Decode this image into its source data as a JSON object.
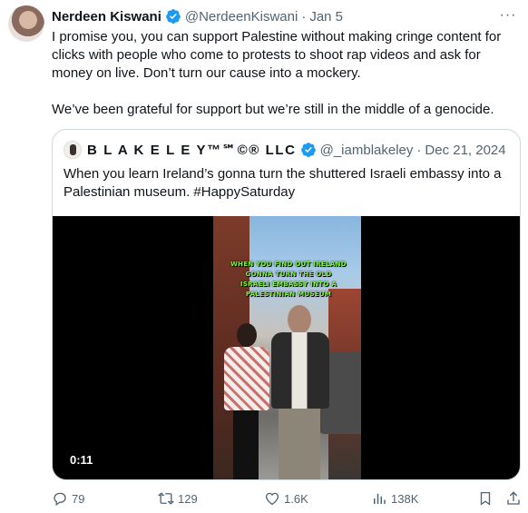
{
  "tweet": {
    "display_name": "Nerdeen Kiswani",
    "handle": "@NerdeenKiswani",
    "separator": "·",
    "date": "Jan 5",
    "more": "···",
    "paragraph1": "I promise you, you can support Palestine without making cringe content for clicks  with people who come to protests to shoot rap videos and ask for money on live. Don’t turn our cause into a mockery.",
    "paragraph2": "We’ve been grateful for support but we’re still in the middle of a genocide."
  },
  "quote": {
    "display_name": "B L A K E L E Y™℠©® LLC",
    "handle": "@_iamblakeley",
    "separator": "·",
    "date": "Dec 21, 2024",
    "text": "When you learn Ireland’s gonna turn the shuttered Israeli embassy into a Palestinian museum. #HappySaturday",
    "video": {
      "overlay_text": "WHEN YOU FIND OUT IRELAND GONNA TURN THE OLD ISRAELI EMBASSY INTO A PALESTINIAN MUSEUM",
      "timer": "0:11"
    }
  },
  "actions": {
    "replies": "79",
    "reposts": "129",
    "likes": "1.6K",
    "views": "138K"
  },
  "colors": {
    "verified": "#1d9bf0",
    "secondary_text": "#536471",
    "border": "#cfd9de"
  }
}
